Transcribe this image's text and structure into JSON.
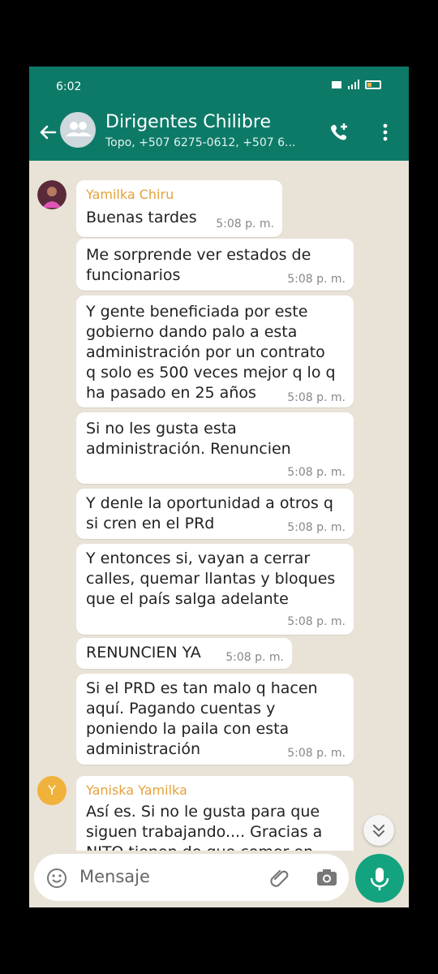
{
  "status": {
    "time": "6:02"
  },
  "header": {
    "title": "Dirigentes Chilibre",
    "subtitle": "Topo, +507 6275-0612, +507 6..."
  },
  "messages": [
    {
      "sender": "Yamilka Chiru",
      "text": "Buenas tardes",
      "time": "5:08 p. m."
    },
    {
      "text": "Me sorprende ver estados de\nfuncionarios",
      "time": "5:08 p. m."
    },
    {
      "text": "Y gente beneficiada por este\ngobierno dando palo a esta\nadministración por un contrato\nq solo es 500 veces mejor q lo q\nha pasado en 25 años",
      "time": "5:08 p. m."
    },
    {
      "text": "Si no les gusta esta\nadministración. Renuncien",
      "time": "5:08 p. m."
    },
    {
      "text": "Y denle la oportunidad a otros q\nsi cren en el PRd",
      "time": "5:08 p. m."
    },
    {
      "text": "Y entonces si, vayan a cerrar\ncalles, quemar llantas  y bloques\nque el país salga adelante",
      "time": "5:08 p. m."
    },
    {
      "text": "RENUNCIEN YA",
      "time": "5:08 p. m."
    },
    {
      "text": "Si el PRD es tan malo q hacen\naquí. Pagando cuentas y\nponiendo la paila con esta\nadministración",
      "time": "5:08 p. m."
    },
    {
      "sender": "Yaniska Yamilka",
      "avatar_letter": "Y",
      "text": "Así es. Si no le gusta para que\nsiguen trabajando.... Gracias a\nNITO tienen de que comer en"
    }
  ],
  "input": {
    "placeholder": "Mensaje"
  },
  "colors": {
    "header": "#0d7a68",
    "accent": "#14a37f",
    "sender": "#e5a13a",
    "wallpaper": "#e9e2d6"
  }
}
